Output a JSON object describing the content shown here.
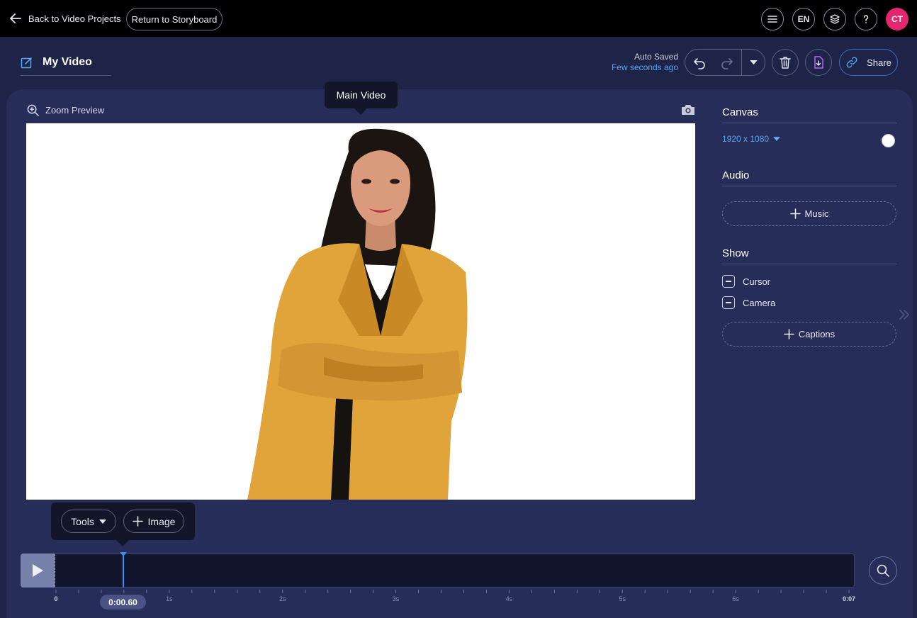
{
  "topbar": {
    "back_label": "Back to Video Projects",
    "storyboard_label": "Return to Storyboard",
    "language": "EN",
    "avatar_initials": "CT",
    "avatar_color": "#e3266e"
  },
  "header": {
    "title": "My Video",
    "autosave_status": "Auto Saved",
    "autosave_time": "Few seconds ago",
    "share_label": "Share"
  },
  "preview": {
    "zoom_label": "Zoom Preview",
    "tooltip": "Main Video",
    "image_description": "woman-in-mustard-blazer-arms-crossed"
  },
  "sidebar": {
    "canvas_heading": "Canvas",
    "canvas_size": "1920 x 1080",
    "canvas_color": "#ffffff",
    "audio_heading": "Audio",
    "music_label": "Music",
    "show_heading": "Show",
    "toggles": [
      {
        "label": "Cursor"
      },
      {
        "label": "Camera"
      }
    ],
    "captions_label": "Captions"
  },
  "tools": {
    "tools_label": "Tools",
    "image_label": "Image"
  },
  "timeline": {
    "current_time": "0:00.60",
    "tick_labels": [
      "0",
      "1s",
      "2s",
      "3s",
      "4s",
      "5s",
      "6s",
      "0:07"
    ],
    "playhead_seconds": 0.6,
    "duration_seconds": 7
  },
  "colors": {
    "accent_blue": "#5aa7ef",
    "background": "#1e2447",
    "panel": "#262d58"
  }
}
